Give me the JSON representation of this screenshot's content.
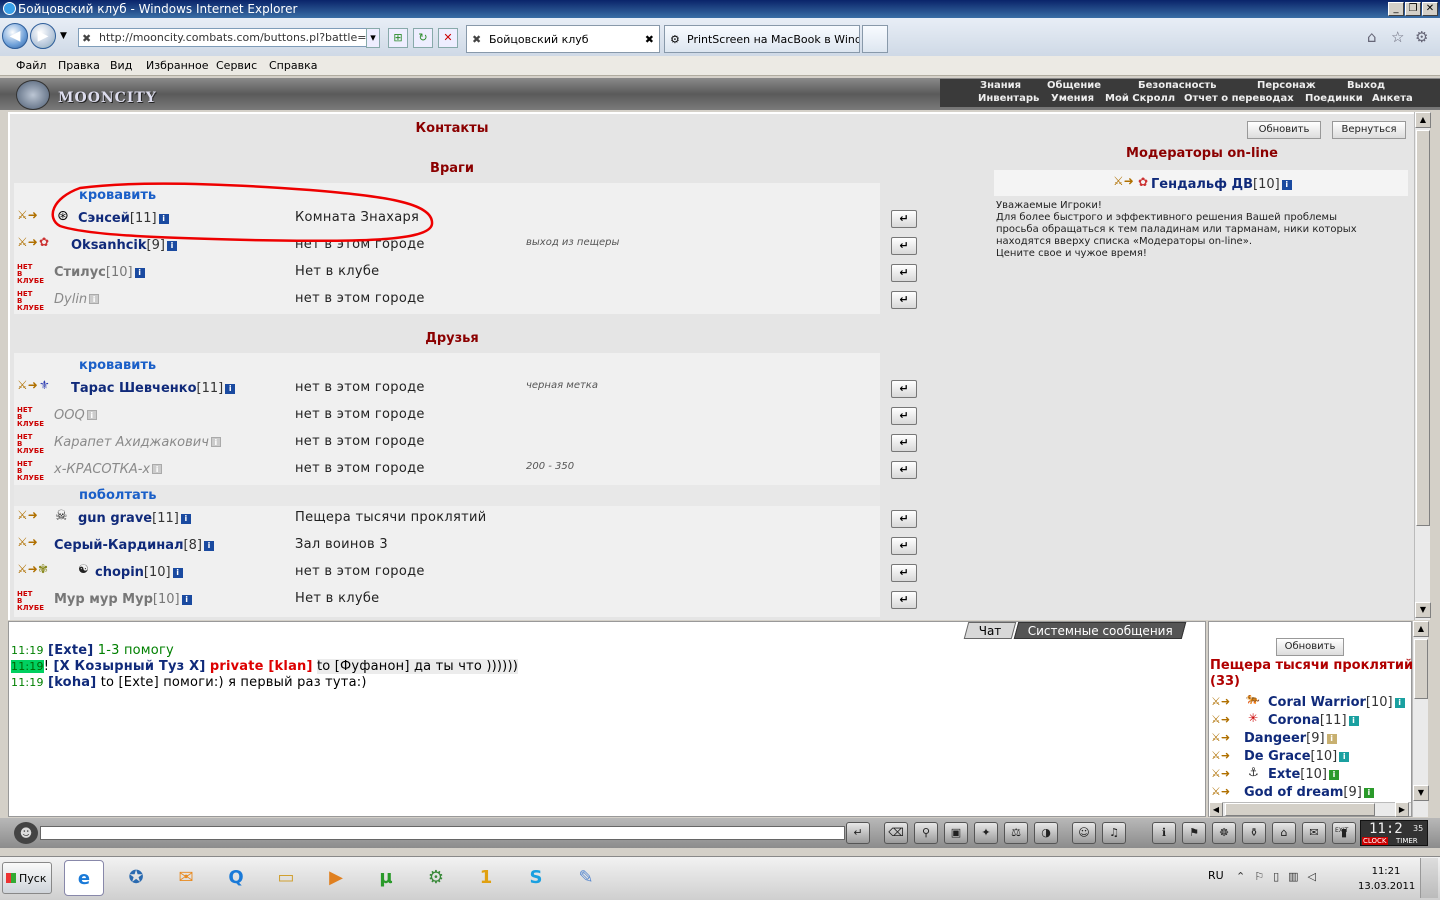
{
  "window": {
    "title": "Бойцовский клуб - Windows Internet Explorer"
  },
  "browser": {
    "address": "http://mooncity.combats.com/buttons.pl?battle=0.",
    "tabs": [
      {
        "label": "Бойцовский клуб",
        "close": "✖"
      },
      {
        "label": "PrintScreen на MacBook в Wind..."
      }
    ],
    "menu": [
      "Файл",
      "Правка",
      "Вид",
      "Избранное",
      "Сервис",
      "Справка"
    ]
  },
  "game": {
    "logo": "MOONCITY",
    "top_menu_row1": [
      "Знания",
      "Общение",
      "Безопасность",
      "Персонаж",
      "Выход"
    ],
    "top_menu_row2": [
      "Инвентарь",
      "Умения",
      "Мой Скролл",
      "Отчет о переводах",
      "Поединки",
      "Анкета"
    ]
  },
  "contacts": {
    "title": "Контакты",
    "refresh_label": "Обновить",
    "back_label": "Вернуться",
    "enemies_title": "Враги",
    "friends_title": "Друзья",
    "offline_badge": "НЕТ В КЛУБЕ",
    "info_glyph": "i",
    "remove_glyph": "↵",
    "enemies_group": "кровавить",
    "enemies": [
      {
        "name": "Сэнсей",
        "level": "[11]",
        "location": "Комната Знахаря",
        "note": "",
        "online": true
      },
      {
        "name": "Oksanhcik",
        "level": "[9]",
        "location": "нет в этом городе",
        "note": "выход из пещеры",
        "online": true
      },
      {
        "name": "Стилус",
        "level": "[10]",
        "location": "Нет в клубе",
        "note": "",
        "online": false
      },
      {
        "name": "Dylin",
        "level": "",
        "location": "нет в этом городе",
        "note": "",
        "online": false
      }
    ],
    "friends_groups": [
      {
        "group": "кровавить",
        "members": [
          {
            "name": "Тарас Шевченко",
            "level": "[11]",
            "location": "нет в этом городе",
            "note": "черная метка",
            "online": true
          },
          {
            "name": "OOQ",
            "level": "",
            "location": "нет в этом городе",
            "note": "",
            "online": false
          },
          {
            "name": "Карапет Ахиджакович",
            "level": "",
            "location": "нет в этом городе",
            "note": "",
            "online": false
          },
          {
            "name": "x-КРАСОТКА-x",
            "level": "",
            "location": "нет в этом городе",
            "note": "200 - 350",
            "online": false
          }
        ]
      },
      {
        "group": "поболтать",
        "members": [
          {
            "name": "gun grave",
            "level": "[11]",
            "location": "Пещера тысячи проклятий",
            "note": "",
            "online": true
          },
          {
            "name": "Серый-Кардинал",
            "level": "[8]",
            "location": "Зал воинов 3",
            "note": "",
            "online": true
          },
          {
            "name": "chopin",
            "level": "[10]",
            "location": "нет в этом городе",
            "note": "",
            "online": true
          },
          {
            "name": "Мур мур Мур",
            "level": "[10]",
            "location": "Нет в клубе",
            "note": "",
            "online": false
          }
        ]
      }
    ]
  },
  "moderators": {
    "title": "Модераторы on-line",
    "name": "Гендальф ДВ",
    "level": "[10]",
    "notice": [
      "Уважаемые Игроки!",
      "Для более быстрого и эффективного решения Вашей проблемы",
      "просьба обращаться к тем паладинам или тарманам, ники которых",
      "находятся вверху списка «Модераторы on-line».",
      "Цените свое и чужое время!"
    ]
  },
  "chat": {
    "tab_chat": "Чат",
    "tab_system": "Системные сообщения",
    "lines": [
      {
        "time": "11:19",
        "prefix": "",
        "from": "[Exte]",
        "mid": "",
        "text": "1-3 помогу"
      },
      {
        "time": "11:19",
        "prefix": "!",
        "from": "[X Козырный Туз X]",
        "mid": "private [klan]",
        "text": "to [Фуфанон] да ты что ))))))"
      },
      {
        "time": "11:19",
        "prefix": "",
        "from": "[koha]",
        "mid": "",
        "text": "to [Exte] помоги:) я первый раз тута:)"
      }
    ]
  },
  "room": {
    "refresh_label": "Обновить",
    "title": "Пещера тысячи проклятий",
    "count": "(33)",
    "players": [
      {
        "name": "Coral Warrior",
        "level": "[10]"
      },
      {
        "name": "Corona",
        "level": "[11]"
      },
      {
        "name": "Dangeer",
        "level": "[9]"
      },
      {
        "name": "De Grace",
        "level": "[10]"
      },
      {
        "name": "Exte",
        "level": "[10]"
      },
      {
        "name": "God of dream",
        "level": "[9]"
      }
    ]
  },
  "clock": {
    "time": "11:2",
    "sec": "35",
    "label_clock": "CLOCK",
    "label_timer": "TIMER",
    "exit": "EXIT"
  },
  "taskbar": {
    "start": "Пуск",
    "lang": "RU",
    "time": "11:21",
    "date": "13.03.2011"
  }
}
